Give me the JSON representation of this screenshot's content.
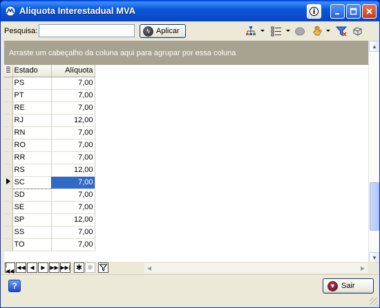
{
  "window": {
    "title": "Aliquota Interestadual MVA"
  },
  "toolbar": {
    "search_label": "Pesquisa:",
    "search_value": "",
    "apply_label": "Aplicar",
    "icons": [
      "hierarchy-icon",
      "list-options-icon",
      "circle-icon",
      "hand-icon",
      "filter-icon",
      "print-icon"
    ]
  },
  "groupbar": {
    "text": "Arraste um cabeçalho da coluna aqui para agrupar por essa coluna"
  },
  "grid": {
    "columns": [
      "Estado",
      "Alíquota"
    ],
    "rows": [
      {
        "estado": "PS",
        "aliquota": "7,00"
      },
      {
        "estado": "PT",
        "aliquota": "7,00"
      },
      {
        "estado": "RE",
        "aliquota": "7,00"
      },
      {
        "estado": "RJ",
        "aliquota": "12,00"
      },
      {
        "estado": "RN",
        "aliquota": "7,00"
      },
      {
        "estado": "RO",
        "aliquota": "7,00"
      },
      {
        "estado": "RR",
        "aliquota": "7,00"
      },
      {
        "estado": "RS",
        "aliquota": "12,00"
      },
      {
        "estado": "SC",
        "aliquota": "7,00",
        "selected": true
      },
      {
        "estado": "SD",
        "aliquota": "7,00"
      },
      {
        "estado": "SE",
        "aliquota": "7,00"
      },
      {
        "estado": "SP",
        "aliquota": "12,00"
      },
      {
        "estado": "SS",
        "aliquota": "7,00"
      },
      {
        "estado": "TO",
        "aliquota": "7,00"
      }
    ]
  },
  "footer": {
    "exit_label": "Sair"
  },
  "colors": {
    "selection": "#316ac5",
    "groupbar": "#a7a390",
    "titlebar": "#0a4fd0"
  }
}
